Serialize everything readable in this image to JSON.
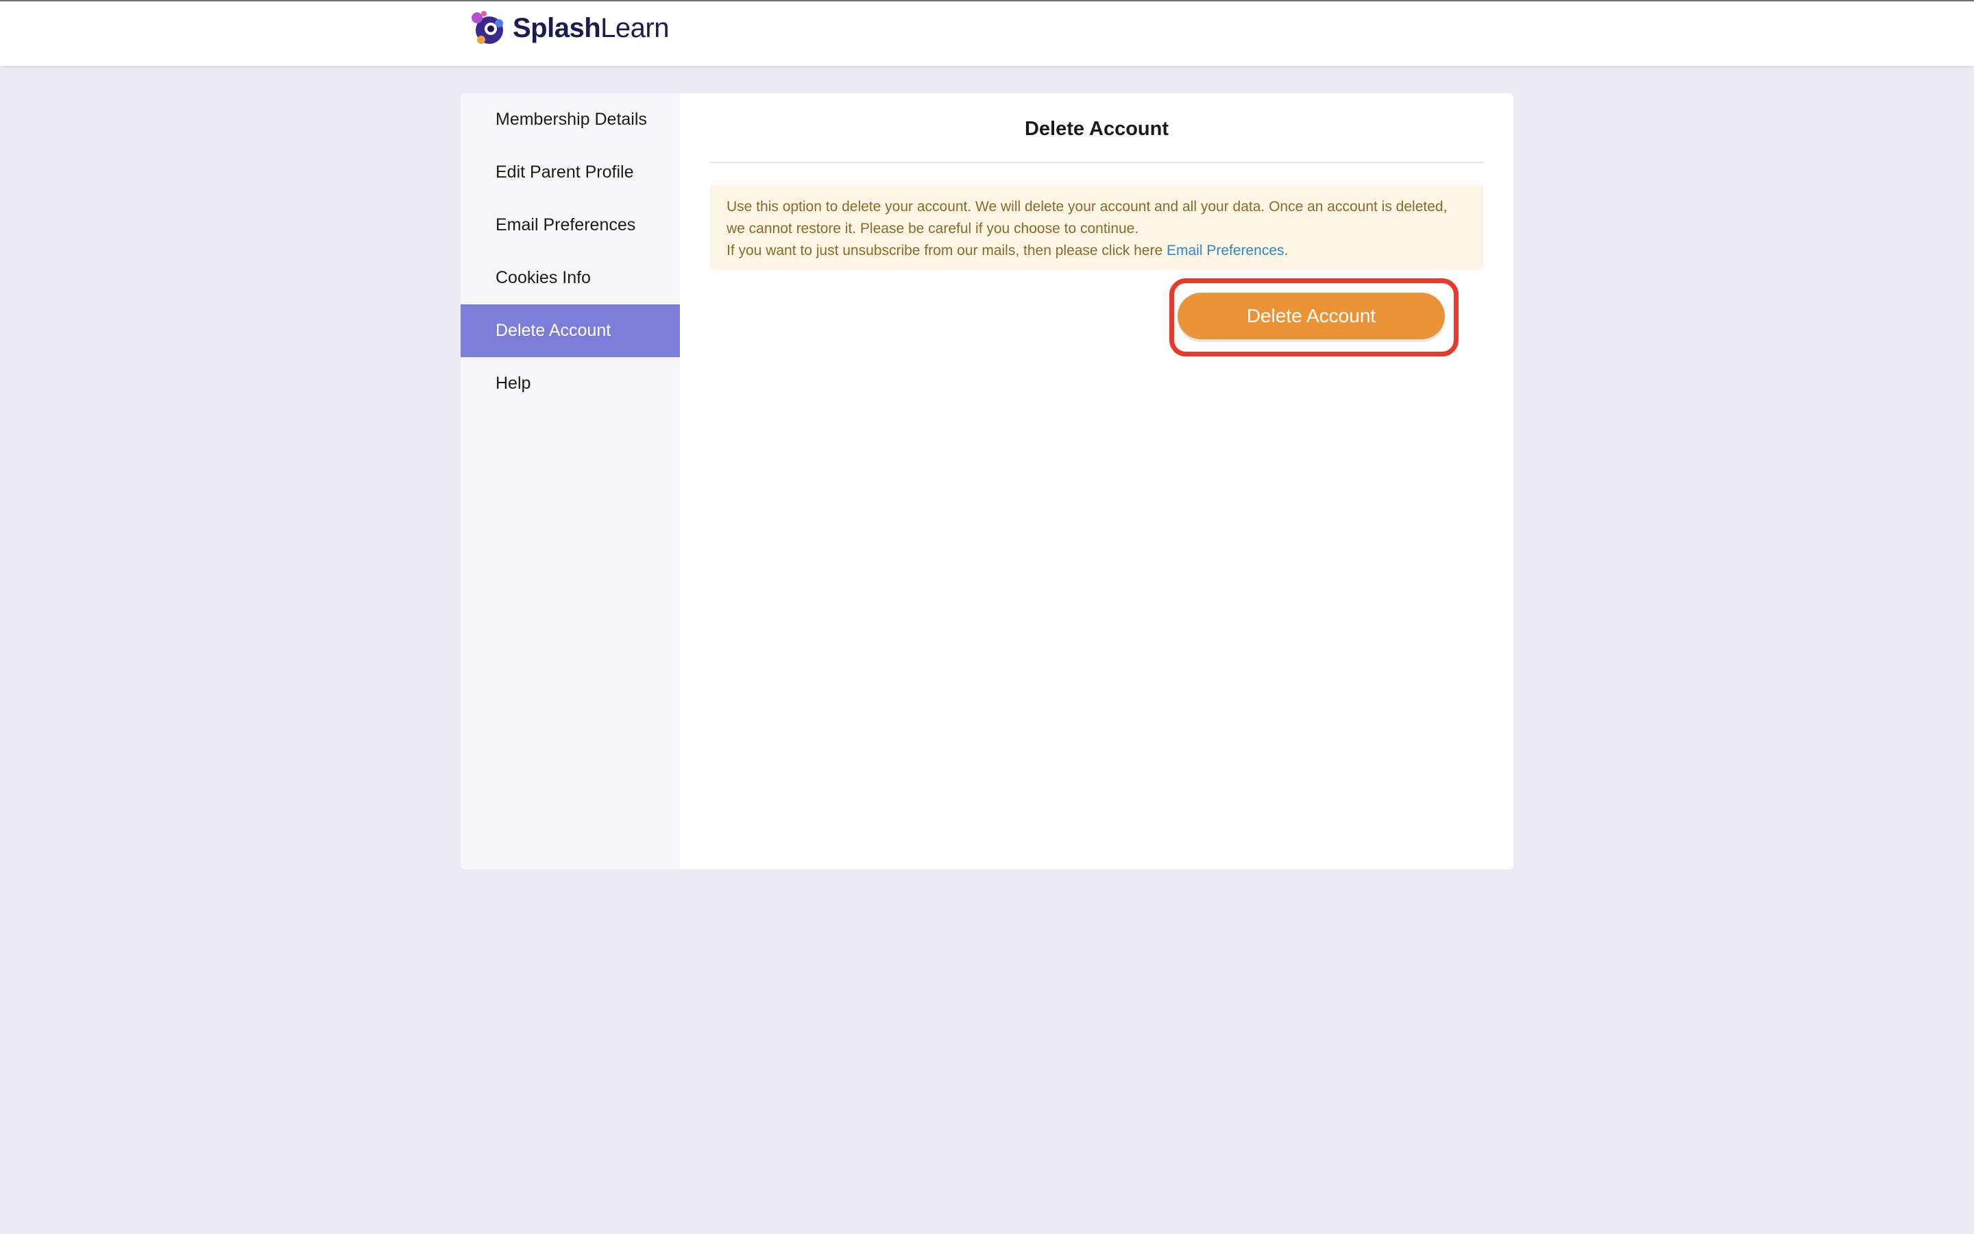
{
  "header": {
    "logo_bold": "Splash",
    "logo_light": "Learn"
  },
  "sidebar": {
    "items": [
      {
        "label": "Membership Details"
      },
      {
        "label": "Edit Parent Profile"
      },
      {
        "label": "Email Preferences"
      },
      {
        "label": "Cookies Info"
      },
      {
        "label": "Delete Account",
        "active": true
      },
      {
        "label": "Help"
      }
    ]
  },
  "main": {
    "title": "Delete Account",
    "notice": {
      "text1": "Use this option to delete your account. We will delete your account and all your data. Once an account is deleted, we cannot restore it. Please be careful if you choose to continue.",
      "text2": "If you want to just unsubscribe from our mails, then please click here ",
      "link": "Email Preferences",
      "text3": "."
    },
    "delete_button_label": "Delete Account"
  },
  "colors": {
    "accent": "#7b7dd9",
    "button": "#ea9337",
    "highlight": "#e8392b",
    "notice_bg": "#fdf6e4",
    "link": "#2f86c9"
  }
}
